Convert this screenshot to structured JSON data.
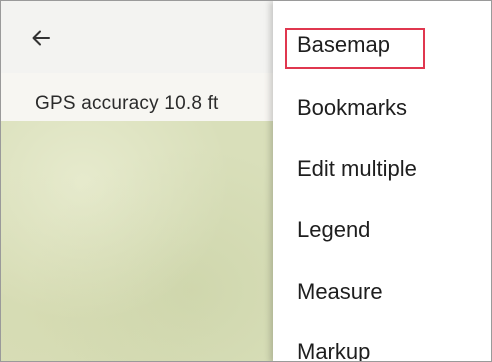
{
  "header": {
    "back_icon": "arrow-left-icon"
  },
  "status": {
    "gps_accuracy": "GPS accuracy 10.8 ft"
  },
  "menu": {
    "items": [
      {
        "label": "Basemap",
        "highlighted": true
      },
      {
        "label": "Bookmarks"
      },
      {
        "label": "Edit multiple"
      },
      {
        "label": "Legend"
      },
      {
        "label": "Measure"
      },
      {
        "label": "Markup"
      }
    ]
  },
  "colors": {
    "highlight": "#e0374f",
    "map_fill": "#d9dfba"
  }
}
